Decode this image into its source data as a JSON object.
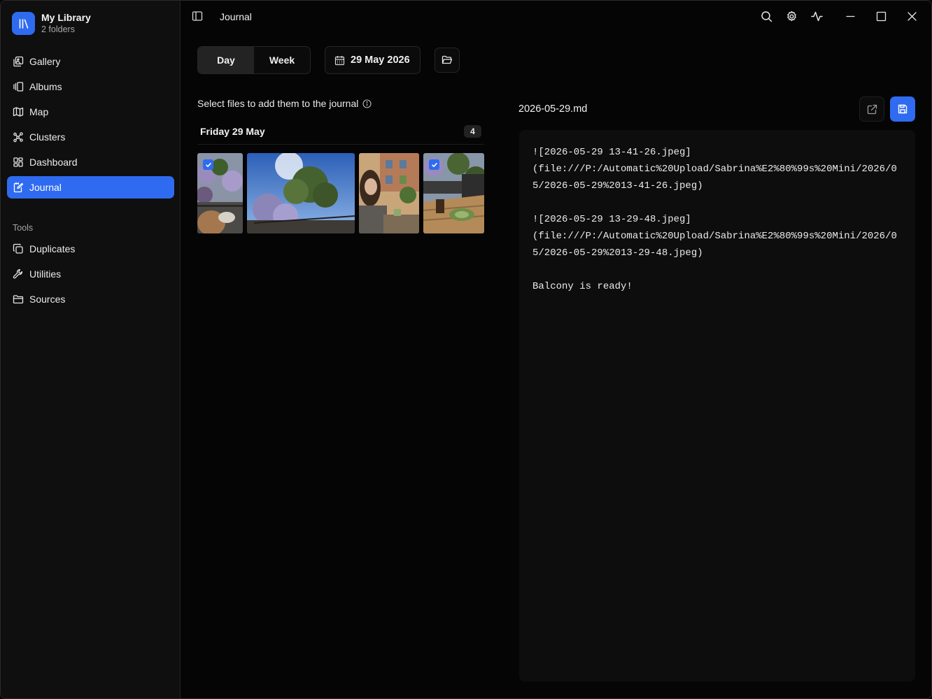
{
  "library": {
    "title": "My Library",
    "subtitle": "2 folders"
  },
  "sidebar": {
    "items": [
      {
        "label": "Gallery",
        "icon": "gallery-icon"
      },
      {
        "label": "Albums",
        "icon": "albums-icon"
      },
      {
        "label": "Map",
        "icon": "map-icon"
      },
      {
        "label": "Clusters",
        "icon": "clusters-icon"
      },
      {
        "label": "Dashboard",
        "icon": "dashboard-icon"
      },
      {
        "label": "Journal",
        "icon": "journal-icon",
        "active": true
      }
    ],
    "tools_label": "Tools",
    "tools": [
      {
        "label": "Duplicates",
        "icon": "duplicates-icon"
      },
      {
        "label": "Utilities",
        "icon": "wrench-icon"
      },
      {
        "label": "Sources",
        "icon": "folder-icon"
      }
    ]
  },
  "titlebar": {
    "title": "Journal"
  },
  "journal": {
    "view_day": "Day",
    "view_week": "Week",
    "selected_view": "Day",
    "date": "29 May 2026",
    "hint": "Select files to add them to the journal",
    "day_heading": "Friday 29 May",
    "day_count": "4",
    "photos": [
      {
        "selected": true
      },
      {
        "selected": false
      },
      {
        "selected": false
      },
      {
        "selected": true
      }
    ]
  },
  "editor": {
    "file_name": "2026-05-29.md",
    "content": "![2026-05-29 13-41-26.jpeg]\n(file:///P:/Automatic%20Upload/Sabrina%E2%80%99s%20Mini/2026/05/2026-05-29%2013-41-26.jpeg)\n\n![2026-05-29 13-29-48.jpeg]\n(file:///P:/Automatic%20Upload/Sabrina%E2%80%99s%20Mini/2026/05/2026-05-29%2013-29-48.jpeg)\n\nBalcony is ready!"
  },
  "colors": {
    "accent": "#2f6bf0",
    "background": "#050505",
    "sidebar": "#0f0f0f"
  }
}
